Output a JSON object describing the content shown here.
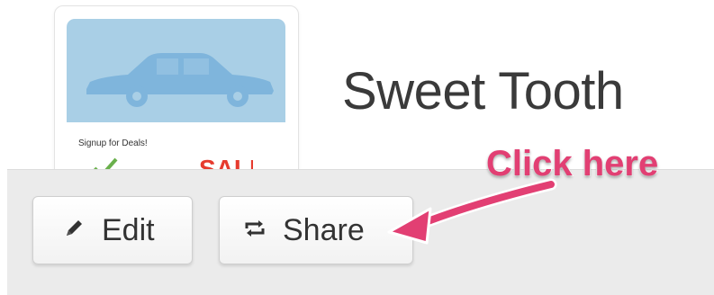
{
  "app": {
    "title": "Sweet Tooth",
    "card": {
      "signup_text": "Signup for Deals!",
      "thumbnail_icon": "car-icon",
      "sale_text": "SALE"
    }
  },
  "toolbar": {
    "edit_label": "Edit",
    "edit_icon": "pencil-icon",
    "share_label": "Share",
    "share_icon": "share-icon"
  },
  "annotation": {
    "text": "Click here",
    "color": "#e23f73"
  },
  "colors": {
    "thumbnail_bg": "#a9cfe6",
    "car": "#7fb5dc",
    "toolbar_bg": "#ebebeb",
    "sale_red": "#e63b2e",
    "check_green": "#6ab04c"
  }
}
